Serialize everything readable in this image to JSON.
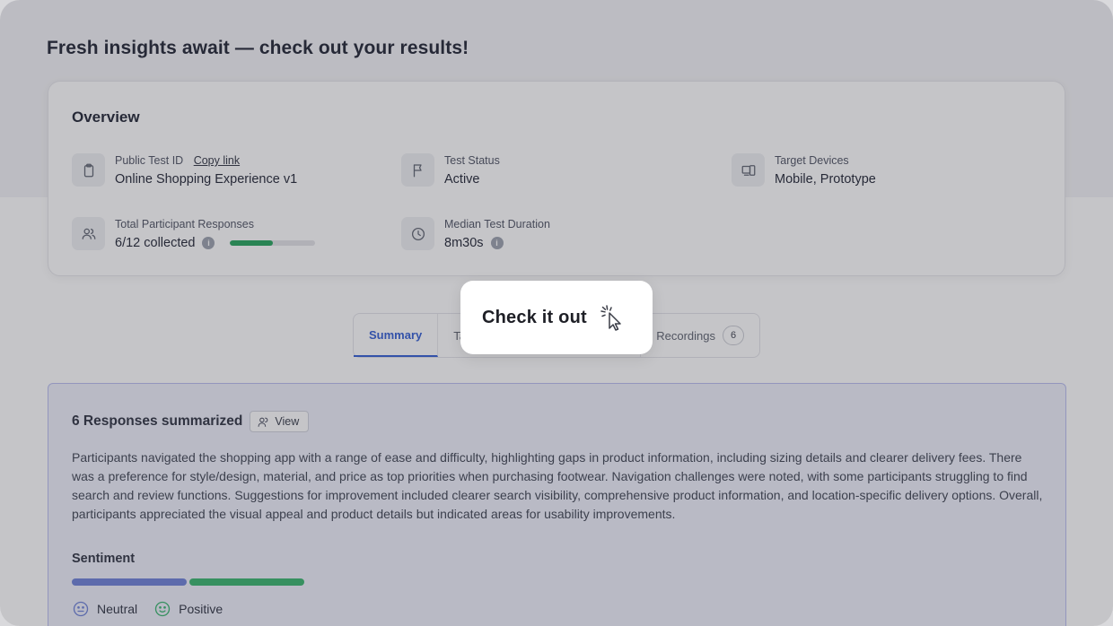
{
  "page": {
    "title": "Fresh insights await — check out your results!"
  },
  "overview": {
    "title": "Overview",
    "public_test_id": {
      "label": "Public Test ID",
      "copy_link": "Copy link",
      "value": "Online Shopping Experience v1",
      "icon": "clipboard-icon"
    },
    "test_status": {
      "label": "Test Status",
      "value": "Active",
      "icon": "flag-icon"
    },
    "target_devices": {
      "label": "Target Devices",
      "value": "Mobile, Prototype",
      "icon": "devices-icon"
    },
    "responses": {
      "label": "Total Participant Responses",
      "value": "6/12 collected",
      "progress": 0.5,
      "icon": "users-icon",
      "progress_color": "#21a35a"
    },
    "duration": {
      "label": "Median Test Duration",
      "value": "8m30s",
      "icon": "clock-icon"
    },
    "info_glyph": "i"
  },
  "tabs": [
    {
      "label": "Summary",
      "active": true
    },
    {
      "label": "Ta",
      "active": false
    },
    {
      "label": "Recordings",
      "count": "6",
      "active": false
    }
  ],
  "summary": {
    "title": "6 Responses summarized",
    "view_label": "View",
    "text": "Participants navigated the shopping app with a range of ease and difficulty, highlighting gaps in product information, including sizing details and clearer delivery fees. There was a preference for style/design, material, and price as top priorities when purchasing footwear. Navigation challenges were noted, with some participants struggling to find search and review functions. Suggestions for improvement included clearer search visibility, comprehensive product information, and location-specific delivery options. Overall, participants appreciated the visual appeal and product details but indicated areas for usability improvements.",
    "sentiment_title": "Sentiment",
    "sentiment": [
      {
        "label": "Neutral",
        "share": 0.5,
        "color": "#6b7fd7",
        "icon": "neutral-face-icon"
      },
      {
        "label": "Positive",
        "share": 0.5,
        "color": "#34b36a",
        "icon": "smile-face-icon"
      }
    ]
  },
  "popup": {
    "label": "Check it out",
    "icon": "click-cursor-icon"
  },
  "colors": {
    "accent": "#2f5bd3",
    "overlay": "rgba(64,64,72,0.30)"
  }
}
